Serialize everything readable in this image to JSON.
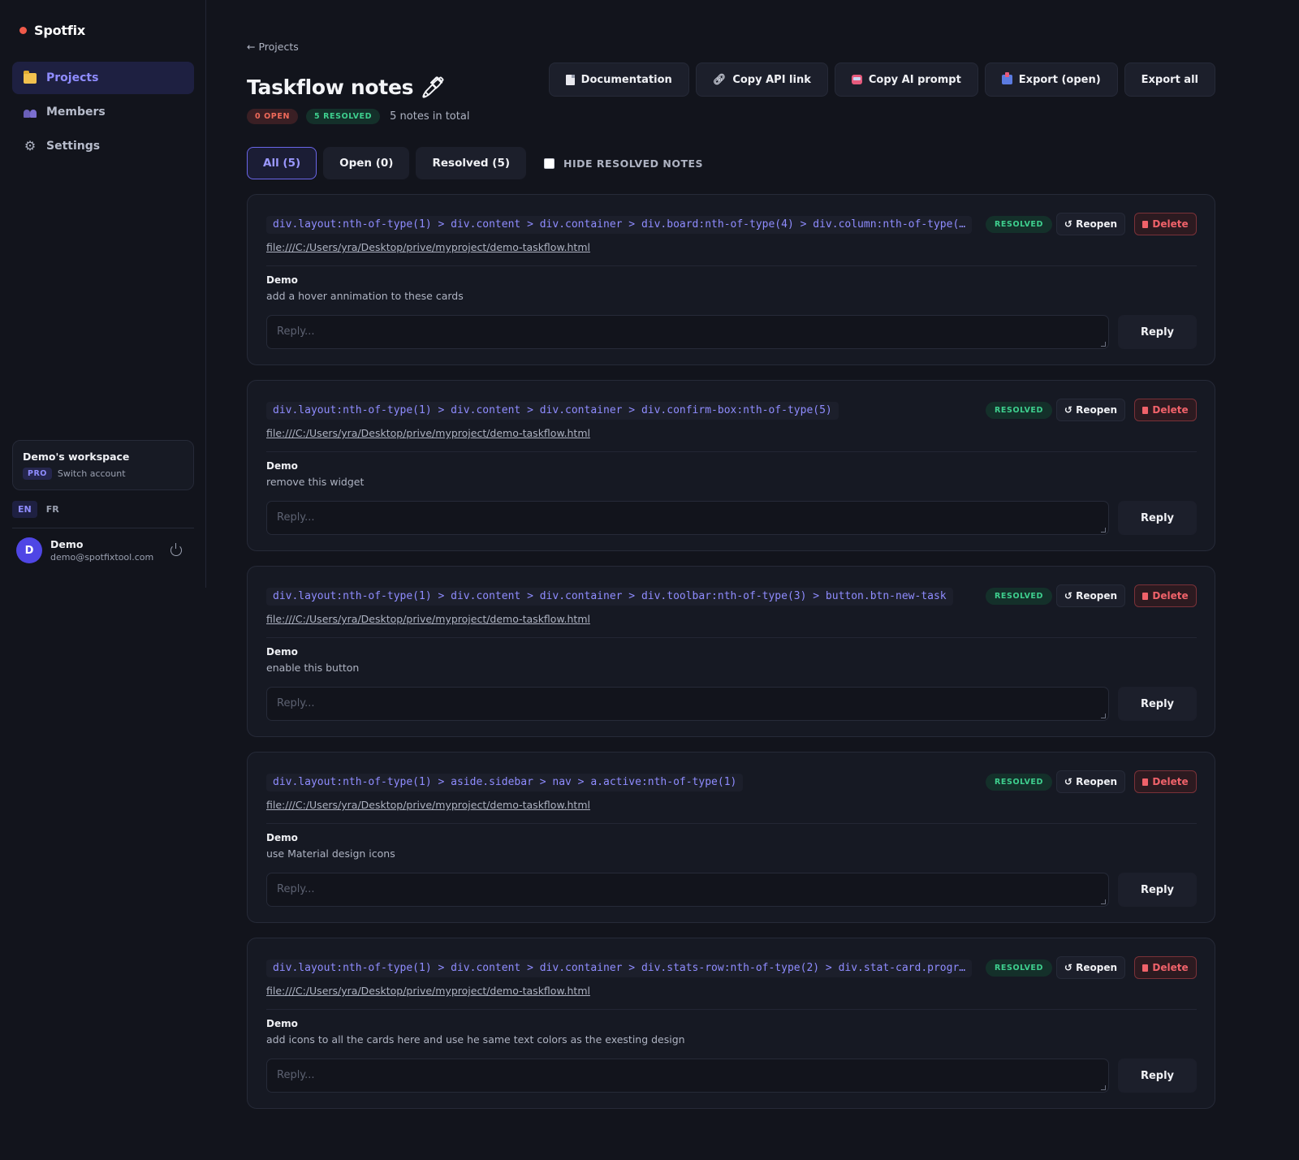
{
  "app": {
    "name": "Spotfix"
  },
  "colors": {
    "accent": "#8f8cff",
    "brand_dot": "#f05a4a",
    "resolved": "#3ecf8e",
    "open": "#ef6a5a",
    "danger": "#f0626a"
  },
  "sidebar": {
    "items": [
      {
        "label": "Projects",
        "icon": "folder-icon",
        "active": true
      },
      {
        "label": "Members",
        "icon": "members-icon"
      },
      {
        "label": "Settings",
        "icon": "gear-icon"
      }
    ],
    "workspace": {
      "name": "Demo's workspace",
      "plan": "PRO",
      "switch_label": "Switch account"
    },
    "languages": [
      "EN",
      "FR"
    ],
    "user": {
      "initial": "D",
      "name": "Demo",
      "email": "demo@spotfixtool.com"
    }
  },
  "header": {
    "back_label": "← Projects",
    "title": "Taskflow notes 🖊",
    "open_badge": "0 OPEN",
    "resolved_badge": "5 RESOLVED",
    "total_text": "5 notes in total"
  },
  "toolbar": {
    "documentation": "Documentation",
    "copy_api": "Copy API link",
    "copy_ai": "Copy AI prompt",
    "export_open": "Export (open)",
    "export_all": "Export all"
  },
  "filters": {
    "all": "All (5)",
    "open": "Open (0)",
    "resolved": "Resolved (5)",
    "hide_label": "HIDE RESOLVED NOTES"
  },
  "note_labels": {
    "status": "RESOLVED",
    "reopen": "↺ Reopen",
    "delete": "Delete",
    "reply_placeholder": "Reply...",
    "reply": "Reply"
  },
  "notes": [
    {
      "selector": "div.layout:nth-of-type(1) > div.content > div.container > div.board:nth-of-type(4) > div.column:nth-of-type(…",
      "url": "file:///C:/Users/yra/Desktop/prive/myproject/demo-taskflow.html",
      "author": "Demo",
      "message": "add a hover annimation to these cards"
    },
    {
      "selector": "div.layout:nth-of-type(1) > div.content > div.container > div.confirm-box:nth-of-type(5)",
      "url": "file:///C:/Users/yra/Desktop/prive/myproject/demo-taskflow.html",
      "author": "Demo",
      "message": "remove this widget"
    },
    {
      "selector": "div.layout:nth-of-type(1) > div.content > div.container > div.toolbar:nth-of-type(3) > button.btn-new-task",
      "url": "file:///C:/Users/yra/Desktop/prive/myproject/demo-taskflow.html",
      "author": "Demo",
      "message": "enable this button"
    },
    {
      "selector": "div.layout:nth-of-type(1) > aside.sidebar > nav > a.active:nth-of-type(1)",
      "url": "file:///C:/Users/yra/Desktop/prive/myproject/demo-taskflow.html",
      "author": "Demo",
      "message": "use Material design icons"
    },
    {
      "selector": "div.layout:nth-of-type(1) > div.content > div.container > div.stats-row:nth-of-type(2) > div.stat-card.progr…",
      "url": "file:///C:/Users/yra/Desktop/prive/myproject/demo-taskflow.html",
      "author": "Demo",
      "message": "add icons to all the cards here and use he same text colors as the exesting design"
    }
  ]
}
